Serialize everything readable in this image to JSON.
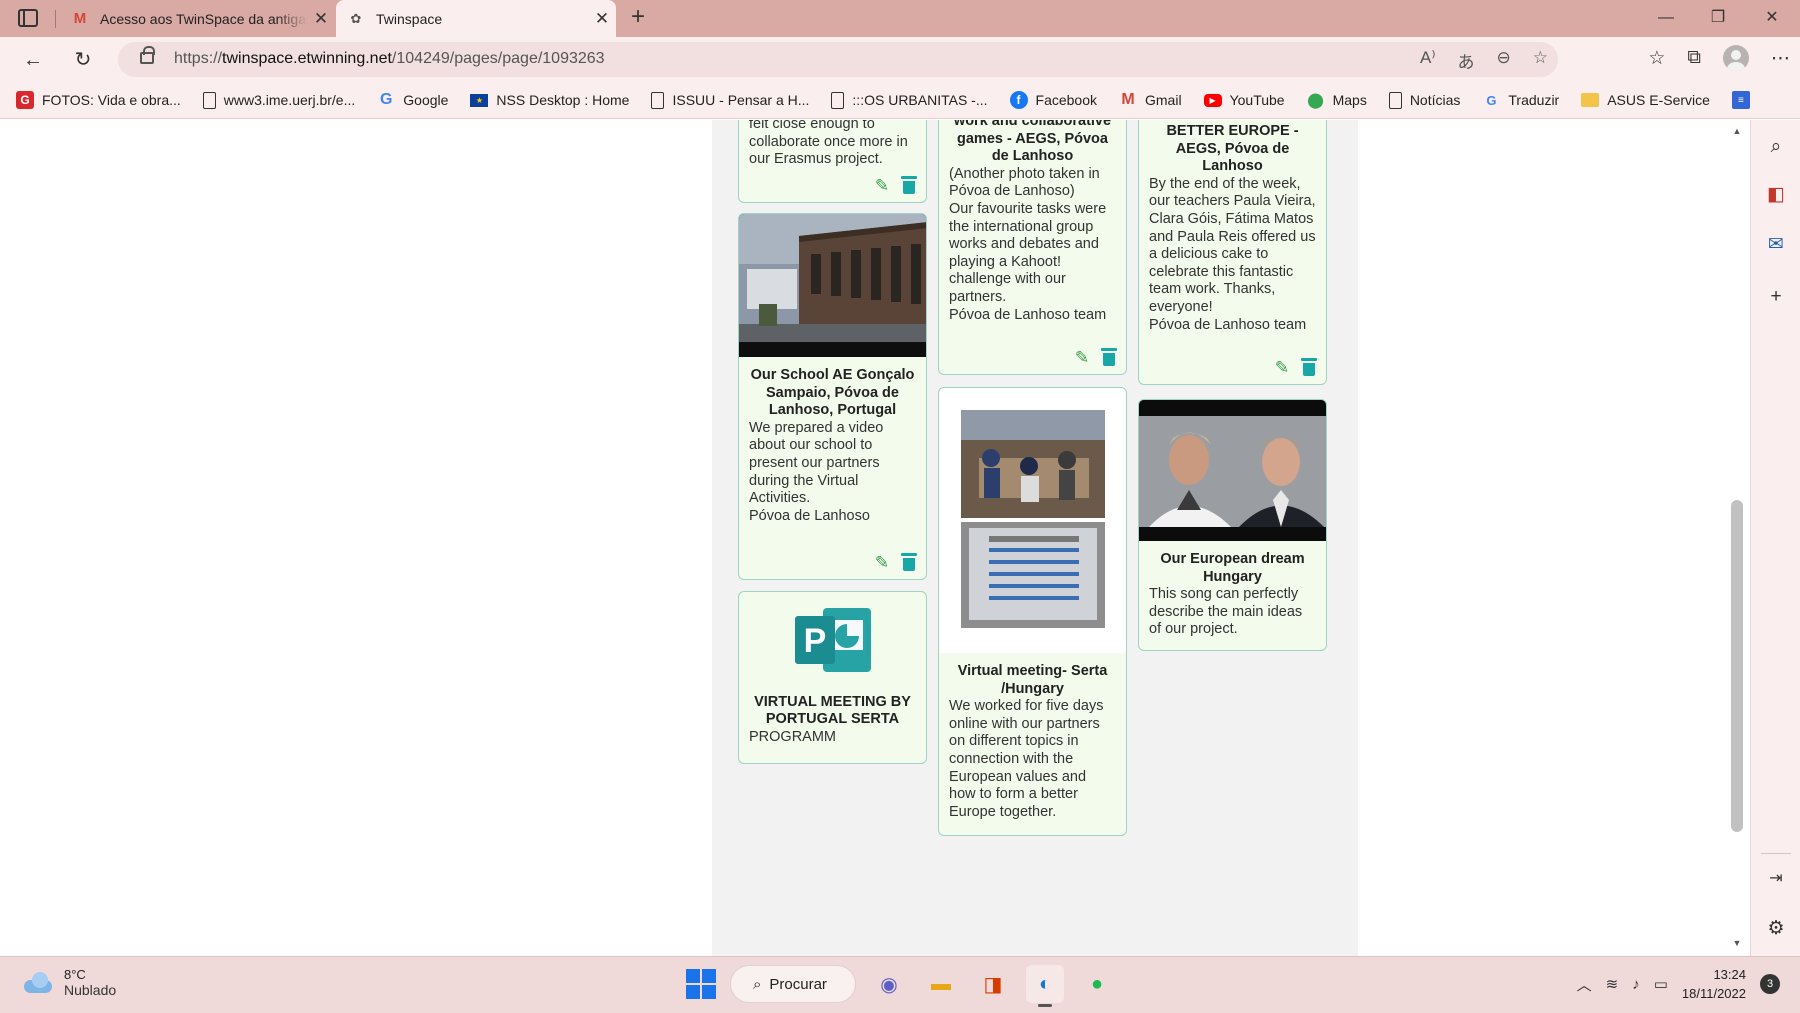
{
  "browser": {
    "tabs": [
      {
        "title": "Acesso aos TwinSpace da antiga",
        "icon": "gmail-icon",
        "active": false
      },
      {
        "title": "Twinspace",
        "icon": "etwinning-icon",
        "active": true
      }
    ],
    "url_prefix": "https://",
    "url_host": "twinspace.etwinning.net",
    "url_path": "/104249/pages/page/1093263",
    "bookmarks": [
      {
        "label": "FOTOS: Vida e obra...",
        "icon": "red-g-icon"
      },
      {
        "label": "www3.ime.uerj.br/e...",
        "icon": "page-icon"
      },
      {
        "label": "Google",
        "icon": "google-icon"
      },
      {
        "label": "NSS Desktop : Home",
        "icon": "eu-flag-icon"
      },
      {
        "label": "ISSUU - Pensar a H...",
        "icon": "page-icon"
      },
      {
        "label": ":::OS URBANITAS -...",
        "icon": "page-icon"
      },
      {
        "label": "Facebook",
        "icon": "facebook-icon"
      },
      {
        "label": "Gmail",
        "icon": "gmail-icon"
      },
      {
        "label": "YouTube",
        "icon": "youtube-icon"
      },
      {
        "label": "Maps",
        "icon": "maps-icon"
      },
      {
        "label": "Notícias",
        "icon": "page-icon"
      },
      {
        "label": "Traduzir",
        "icon": "translate-icon"
      },
      {
        "label": "ASUS E-Service",
        "icon": "folder-icon"
      }
    ]
  },
  "cards": {
    "c1": {
      "text": "felt close enough to collaborate once more in our Erasmus project."
    },
    "c2": {
      "title": "Our School AE Gonçalo Sampaio, Póvoa de Lanhoso, Portugal",
      "text": "We prepared a video about our school to present our partners during the Virtual Activities.",
      "text2": "Póvoa de Lanhoso"
    },
    "c3": {
      "title": "VIRTUAL MEETING BY PORTUGAL SERTA",
      "text": "PROGRAMM"
    },
    "c4": {
      "title": "work and collaborative games - AEGS, Póvoa de Lanhoso",
      "text": "(Another photo taken in Póvoa de Lanhoso)",
      "text2": "Our favourite tasks were the international group works and debates and playing a Kahoot! challenge with our partners.",
      "text3": "Póvoa de Lanhoso team"
    },
    "c5": {
      "title": "Virtual meeting- Serta /Hungary",
      "text": "We worked for five days online with our partners on different topics in connection with the European values and how to form a better Europe together."
    },
    "c6": {
      "title": "BETTER EUROPE - AEGS, Póvoa de Lanhoso",
      "text": "By the end of the week, our teachers Paula Vieira, Clara Góis, Fátima Matos and Paula Reis offered us a delicious cake to celebrate this fantastic team work. Thanks, everyone!",
      "text2": "Póvoa de Lanhoso team"
    },
    "c7": {
      "title": "Our European dream Hungary",
      "text": "This song can perfectly describe the main ideas of our project."
    }
  },
  "taskbar": {
    "temp": "8°C",
    "condition": "Nublado",
    "search_label": "Procurar",
    "time": "13:24",
    "date": "18/11/2022",
    "notifications": "3"
  },
  "colors": {
    "card_bg": "#f2fbec",
    "card_border": "#9fd3c5",
    "trash": "#17a7a6",
    "pencil": "#3a9c4a",
    "tabstrip": "#d9a9a4"
  }
}
